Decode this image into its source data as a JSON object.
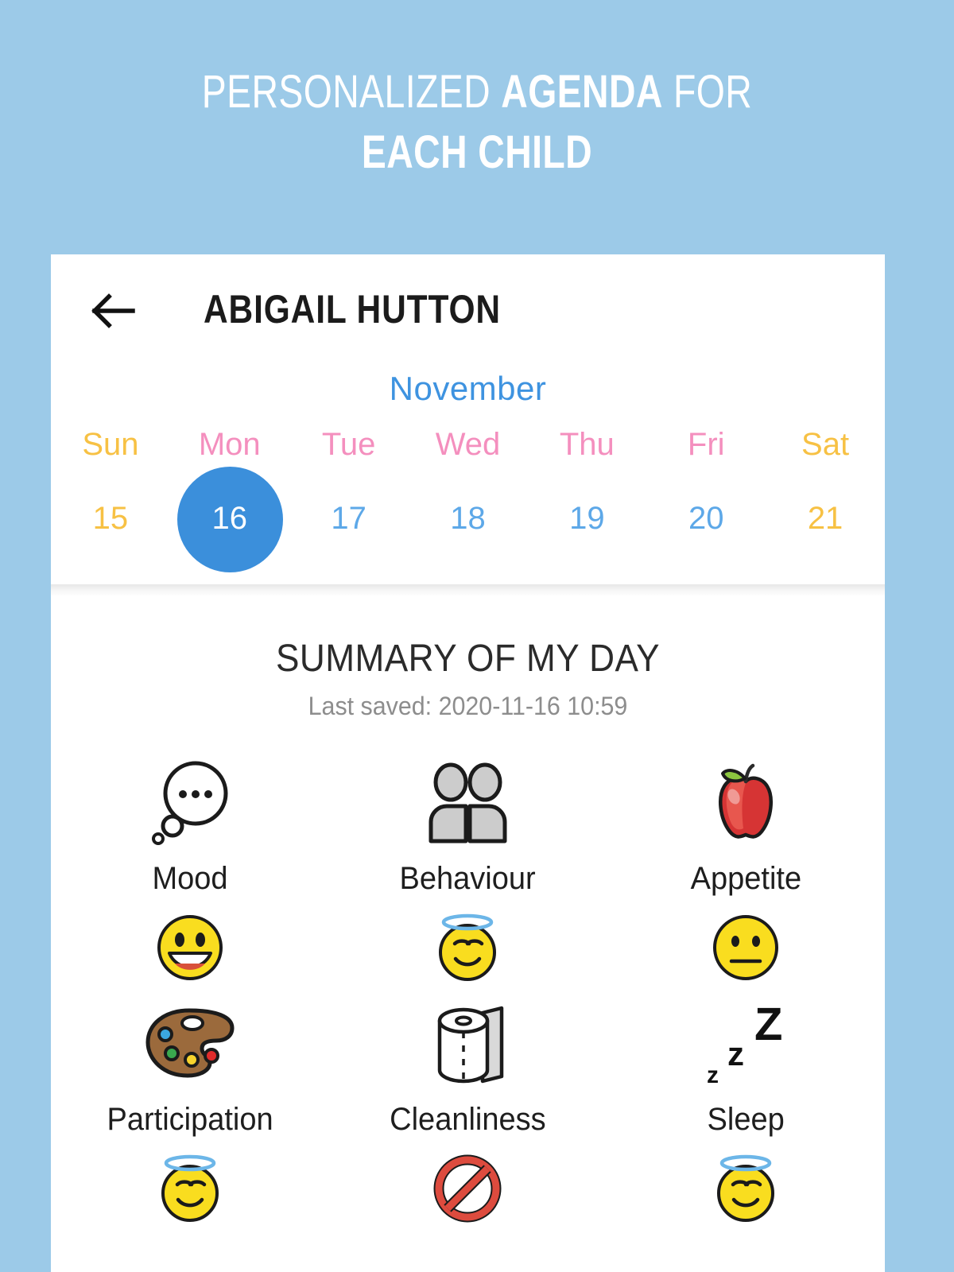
{
  "promo": {
    "line1_plain_a": "PERSONALIZED ",
    "line1_bold": "AGENDA",
    "line1_plain_b": " FOR",
    "line2": "EACH CHILD"
  },
  "appbar": {
    "back_icon": "arrow-left-icon",
    "title": "ABIGAIL HUTTON"
  },
  "calendar": {
    "month": "November",
    "days": [
      {
        "dow": "Sun",
        "date": "15",
        "type": "weekend",
        "selected": false
      },
      {
        "dow": "Mon",
        "date": "16",
        "type": "weekday",
        "selected": true
      },
      {
        "dow": "Tue",
        "date": "17",
        "type": "weekday",
        "selected": false
      },
      {
        "dow": "Wed",
        "date": "18",
        "type": "weekday",
        "selected": false
      },
      {
        "dow": "Thu",
        "date": "19",
        "type": "weekday",
        "selected": false
      },
      {
        "dow": "Fri",
        "date": "20",
        "type": "weekday",
        "selected": false
      },
      {
        "dow": "Sat",
        "date": "21",
        "type": "weekend",
        "selected": false
      }
    ],
    "colors": {
      "month": "#3e93e0",
      "weekday_name": "#f48fbe",
      "weekend_name": "#f7c144",
      "weekday_number": "#5da8e8",
      "weekend_number": "#f7c144",
      "selected_circle": "#3b8fdb",
      "selected_text": "#ffffff"
    }
  },
  "summary": {
    "title": "SUMMARY OF MY DAY",
    "last_saved": "Last saved: 2020-11-16 10:59",
    "metrics": [
      {
        "label": "Mood",
        "icon": "thought-bubble-icon",
        "rating_icon": "grinning-face-emoji"
      },
      {
        "label": "Behaviour",
        "icon": "two-people-icon",
        "rating_icon": "smiling-face-with-halo-emoji"
      },
      {
        "label": "Appetite",
        "icon": "apple-icon",
        "rating_icon": "neutral-face-emoji"
      },
      {
        "label": "Participation",
        "icon": "artist-palette-icon",
        "rating_icon": "smiling-face-with-halo-emoji"
      },
      {
        "label": "Cleanliness",
        "icon": "toilet-paper-icon",
        "rating_icon": "prohibited-sign-emoji"
      },
      {
        "label": "Sleep",
        "icon": "zzz-icon",
        "rating_icon": "smiling-face-with-halo-emoji"
      }
    ]
  },
  "theme": {
    "page_background": "#9ccae8",
    "card_background": "#ffffff",
    "heading_text": "#ffffff"
  }
}
